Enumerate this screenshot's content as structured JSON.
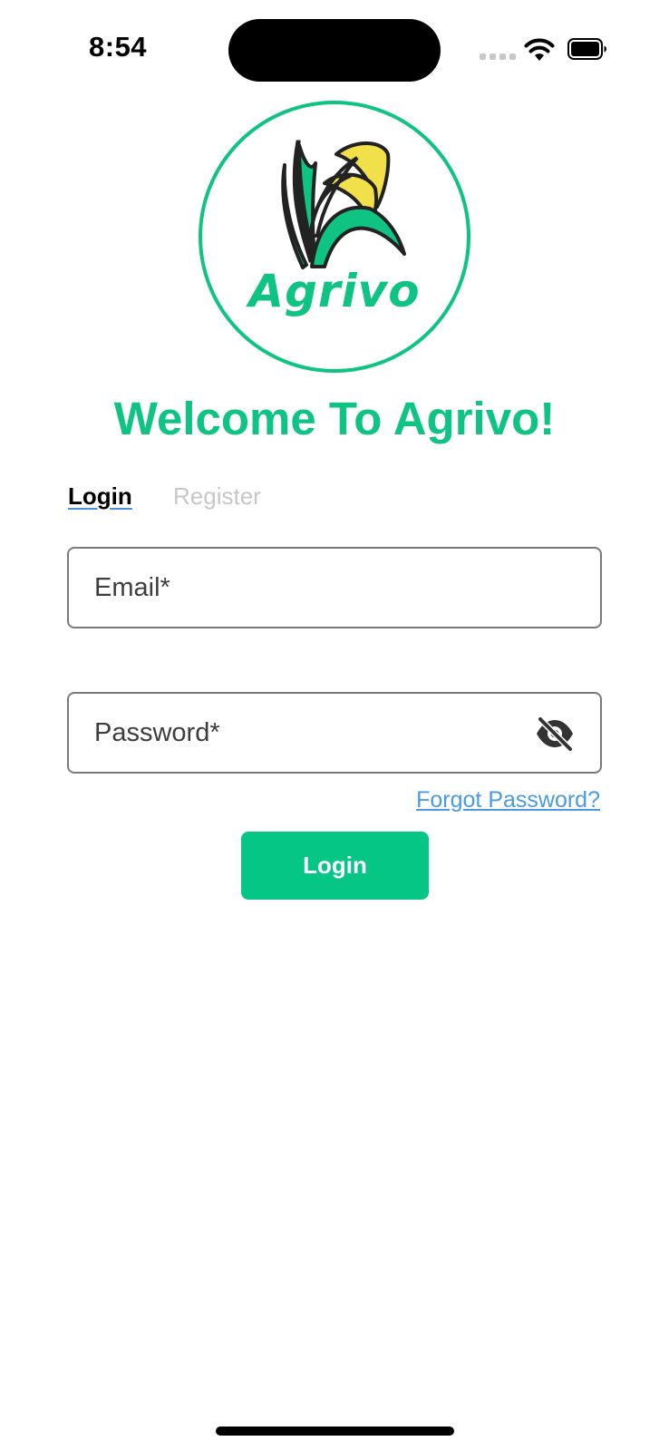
{
  "status_bar": {
    "time": "8:54"
  },
  "logo": {
    "wordmark": "Agrivo",
    "icon": "rice-plant-icon",
    "colors": {
      "ring": "#0fc383",
      "leaf": "#0fc383",
      "grain": "#f2e04b",
      "outline": "#222222"
    }
  },
  "heading": "Welcome To Agrivo!",
  "tabs": [
    {
      "label": "Login",
      "active": true
    },
    {
      "label": "Register",
      "active": false
    }
  ],
  "form": {
    "email": {
      "placeholder": "Email*",
      "value": ""
    },
    "password": {
      "placeholder": "Password*",
      "value": "",
      "visibility_icon": "eye-off-icon"
    },
    "forgot_label": "Forgot Password?",
    "submit_label": "Login"
  },
  "colors": {
    "accent": "#0fc383",
    "button": "#06c685",
    "link": "#4a9be2",
    "inactive_tab": "#c7c7c7"
  }
}
